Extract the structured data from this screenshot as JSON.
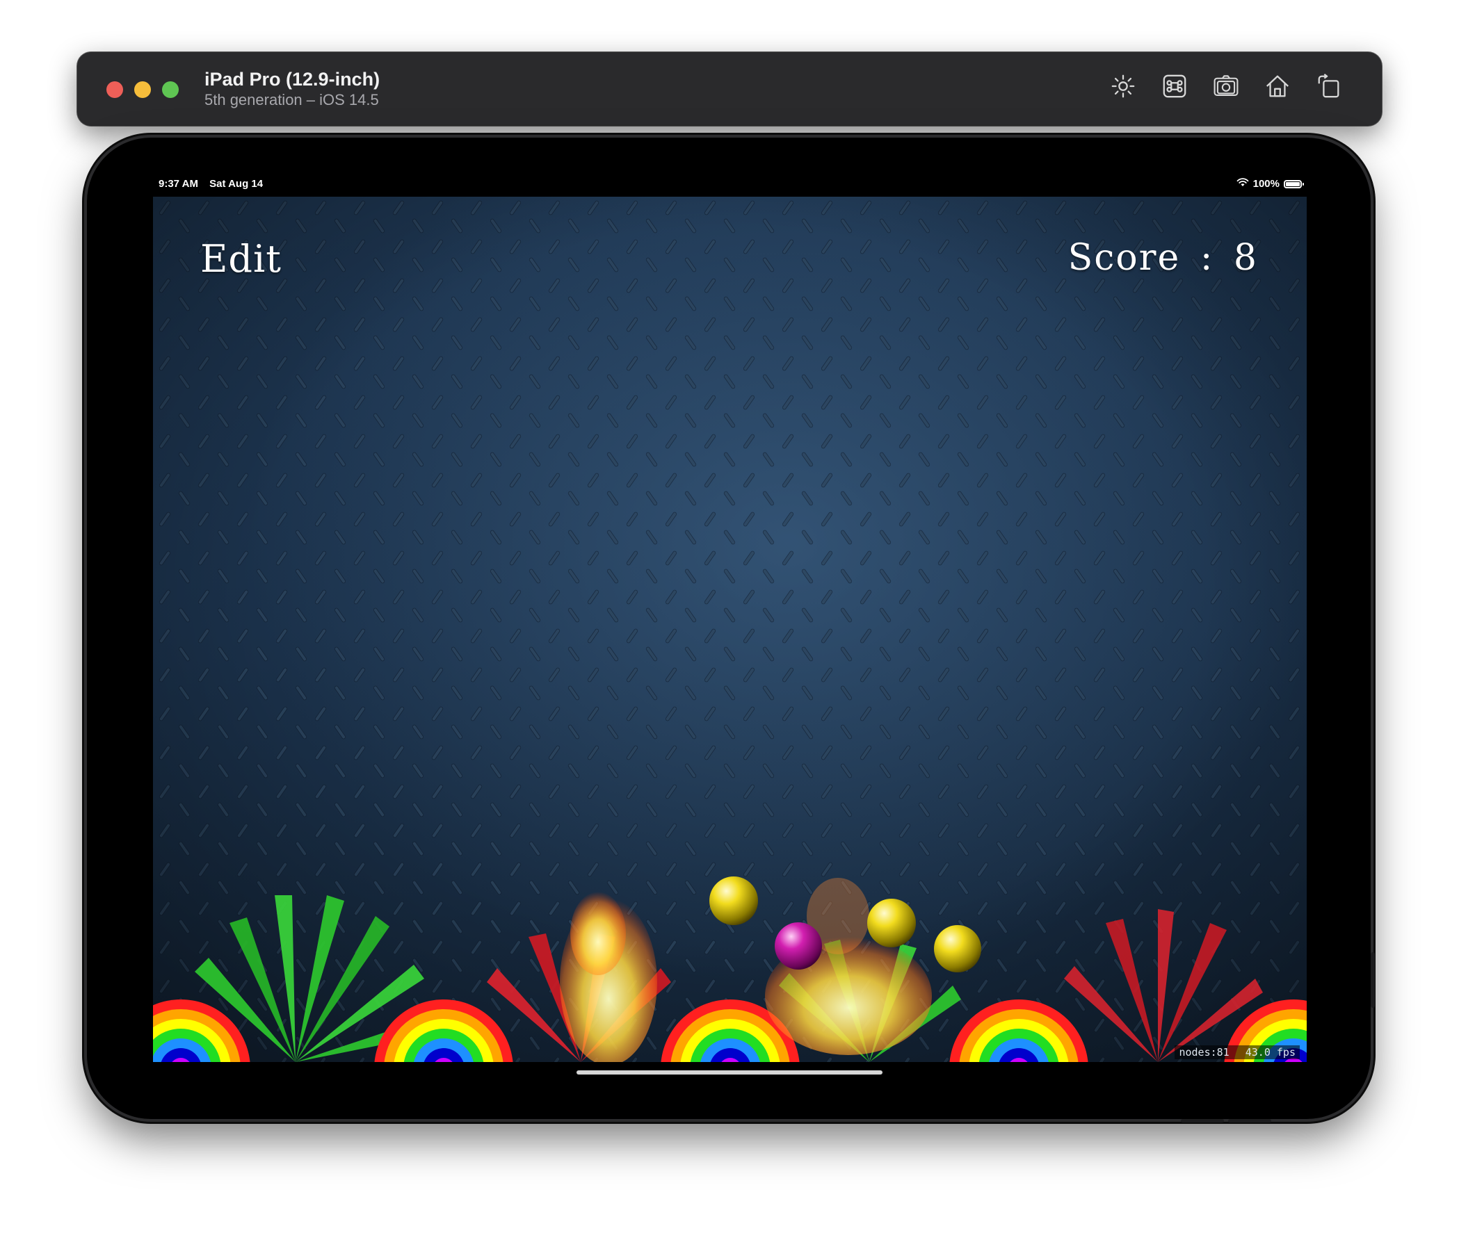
{
  "window": {
    "device_name": "iPad Pro (12.9-inch)",
    "device_subtitle": "5th generation – iOS 14.5",
    "toolbar_icons": [
      "brightness-icon",
      "command-key-icon",
      "screenshot-camera-icon",
      "home-icon",
      "rotate-icon"
    ]
  },
  "status_bar": {
    "time": "9:37 AM",
    "date": "Sat Aug 14",
    "battery": "100%",
    "icons": [
      "wifi-icon",
      "battery-icon"
    ]
  },
  "game": {
    "edit_label": "Edit",
    "score_label": "Score",
    "score_separator": ":",
    "score_value": "8",
    "debug_nodes": "nodes:81",
    "debug_fps": "43.0 fps",
    "balls": [
      "yellow",
      "magenta",
      "yellow",
      "yellow"
    ],
    "background": "diamond-plate metal, dark blue",
    "colors": {
      "rainbow": [
        "#ff2020",
        "#ffa500",
        "#ffff00",
        "#22dd22",
        "#1e90ff",
        "#0000cc",
        "#cc00ff"
      ]
    }
  }
}
